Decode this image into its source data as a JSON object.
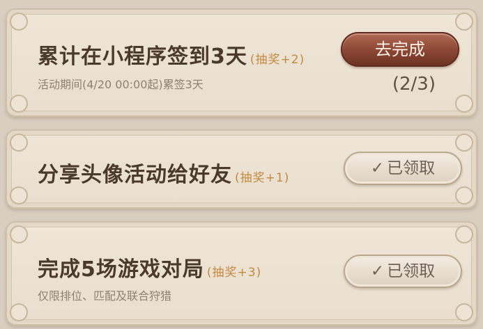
{
  "tasks": [
    {
      "title": "累计在小程序签到3天",
      "reward": "(抽奖+2)",
      "description": "活动期间(4/20 00:00起)累签3天",
      "button_label": "去完成",
      "progress": "(2/3)"
    },
    {
      "title": "分享头像活动给好友",
      "reward": "(抽奖+1)",
      "button_label": "已领取",
      "check_icon": "✓"
    },
    {
      "title": "完成5场游戏对局",
      "reward": "(抽奖+3)",
      "description": "仅限排位、匹配及联合狩猎",
      "button_label": "已领取",
      "check_icon": "✓"
    }
  ]
}
